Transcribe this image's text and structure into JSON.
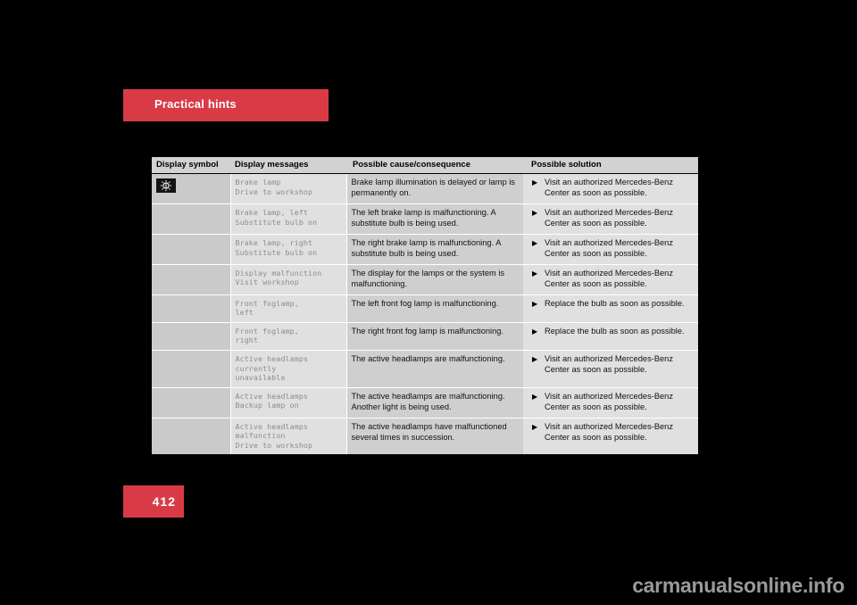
{
  "page": {
    "section_title": "Practical hints",
    "page_number": "412",
    "watermark": "carmanualsonline.info",
    "accent_color": "#d93b46",
    "background_color": "#000000",
    "table_background_color": "#dcdcdc"
  },
  "table": {
    "headers": {
      "symbol": "Display symbol",
      "message": "Display messages",
      "cause": "Possible cause/consequence",
      "solution": "Possible solution"
    },
    "symbol_icon": "brake-lamp-indicator-icon",
    "bullet_glyph": "▶",
    "rows": [
      {
        "message": "Brake lamp\nDrive to workshop",
        "cause": "Brake lamp illumination is delayed or lamp is permanently on.",
        "solution": "Visit an authorized Mercedes-Benz Center as soon as possible."
      },
      {
        "message": "Brake lamp, left\nSubstitute bulb on",
        "cause": "The left brake lamp is malfunctioning. A substitute bulb is being used.",
        "solution": "Visit an authorized Mercedes-Benz Center as soon as possible."
      },
      {
        "message": "Brake lamp, right\nSubstitute bulb on",
        "cause": "The right brake lamp is malfunctioning. A substitute bulb is being used.",
        "solution": "Visit an authorized Mercedes-Benz Center as soon as possible."
      },
      {
        "message": "Display malfunction\nVisit workshop",
        "cause": "The display for the lamps or the system is malfunctioning.",
        "solution": "Visit an authorized Mercedes-Benz Center as soon as possible."
      },
      {
        "message": "Front foglamp,\nleft",
        "cause": "The left front fog lamp is malfunctioning.",
        "solution": "Replace the bulb as soon as possible."
      },
      {
        "message": "Front foglamp,\nright",
        "cause": "The right front fog lamp is malfunctioning.",
        "solution": "Replace the bulb as soon as possible."
      },
      {
        "message": "Active headlamps\ncurrently\nunavailable",
        "cause": "The active headlamps are malfunctioning.",
        "solution": "Visit an authorized Mercedes-Benz Center as soon as possible."
      },
      {
        "message": "Active headlamps\nBackup lamp on",
        "cause": "The active headlamps are malfunctioning. Another light is being used.",
        "solution": "Visit an authorized Mercedes-Benz Center as soon as possible."
      },
      {
        "message": "Active headlamps\nmalfunction\nDrive to workshop",
        "cause": "The active headlamps have malfunctioned several times in succession.",
        "solution": "Visit an authorized Mercedes-Benz Center as soon as possible."
      }
    ]
  }
}
